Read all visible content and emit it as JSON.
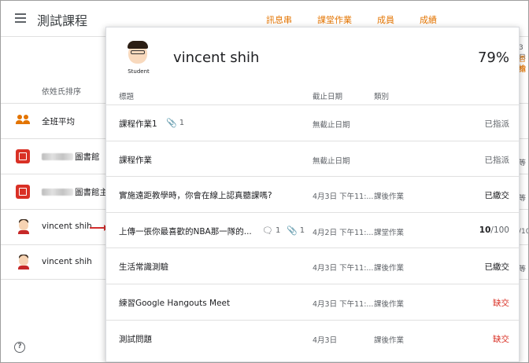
{
  "header": {
    "title": "測試課程",
    "tabs": [
      "訊息串",
      "課堂作業",
      "成員",
      "成績"
    ]
  },
  "background": {
    "sort_label": "依姓氏排序",
    "rows": [
      {
        "label": "全班平均",
        "icon": "people-icon"
      },
      {
        "label": "圖書館",
        "icon": "library-icon"
      },
      {
        "label": "圖書館主",
        "icon": "library-icon"
      },
      {
        "label": "vincent shih",
        "icon": "student-avatar"
      },
      {
        "label": "vincent shih",
        "icon": "student-avatar"
      }
    ],
    "right_peek": [
      "3日",
      "否指",
      "檢",
      "等",
      "等",
      "/100",
      "等"
    ]
  },
  "card": {
    "avatar_tag": "Student",
    "student_name": "vincent shih",
    "percent": "79%",
    "columns": {
      "title": "標題",
      "due": "截止日期",
      "category": "類別"
    },
    "rows": [
      {
        "title": "課程作業1",
        "comments": "",
        "attachments": "1",
        "due": "無截止日期",
        "category": "",
        "status": "已指派",
        "status_style": "grey"
      },
      {
        "title": "課程作業",
        "comments": "",
        "attachments": "",
        "due": "無截止日期",
        "category": "",
        "status": "已指派",
        "status_style": "grey"
      },
      {
        "title": "實施遠距教學時，你會在線上認真聽課嗎?",
        "comments": "",
        "attachments": "",
        "due": "4月3日 下午11:...",
        "category": "課後作業",
        "status": "已繳交",
        "status_style": "black"
      },
      {
        "title": "上傳一張你最喜歡的NBA那一隊的...",
        "comments": "1",
        "attachments": "1",
        "due": "4月2日 下午11:...",
        "category": "課堂作業",
        "score": "10",
        "score_total": "/100",
        "status_style": "score"
      },
      {
        "title": "生活常識測驗",
        "comments": "",
        "attachments": "",
        "due": "4月3日 下午11:...",
        "category": "課後作業",
        "status": "已繳交",
        "status_style": "black"
      },
      {
        "title": "練習Google Hangouts Meet",
        "comments": "",
        "attachments": "",
        "due": "4月3日 下午11:...",
        "category": "課後作業",
        "status": "缺交",
        "status_style": "red"
      },
      {
        "title": "測試問題",
        "comments": "",
        "attachments": "",
        "due": "4月3日",
        "category": "課後作業",
        "status": "缺交",
        "status_style": "red"
      }
    ]
  },
  "colors": {
    "accent": "#e37400",
    "missing": "#d93025",
    "arrow": "#d32f2f"
  }
}
